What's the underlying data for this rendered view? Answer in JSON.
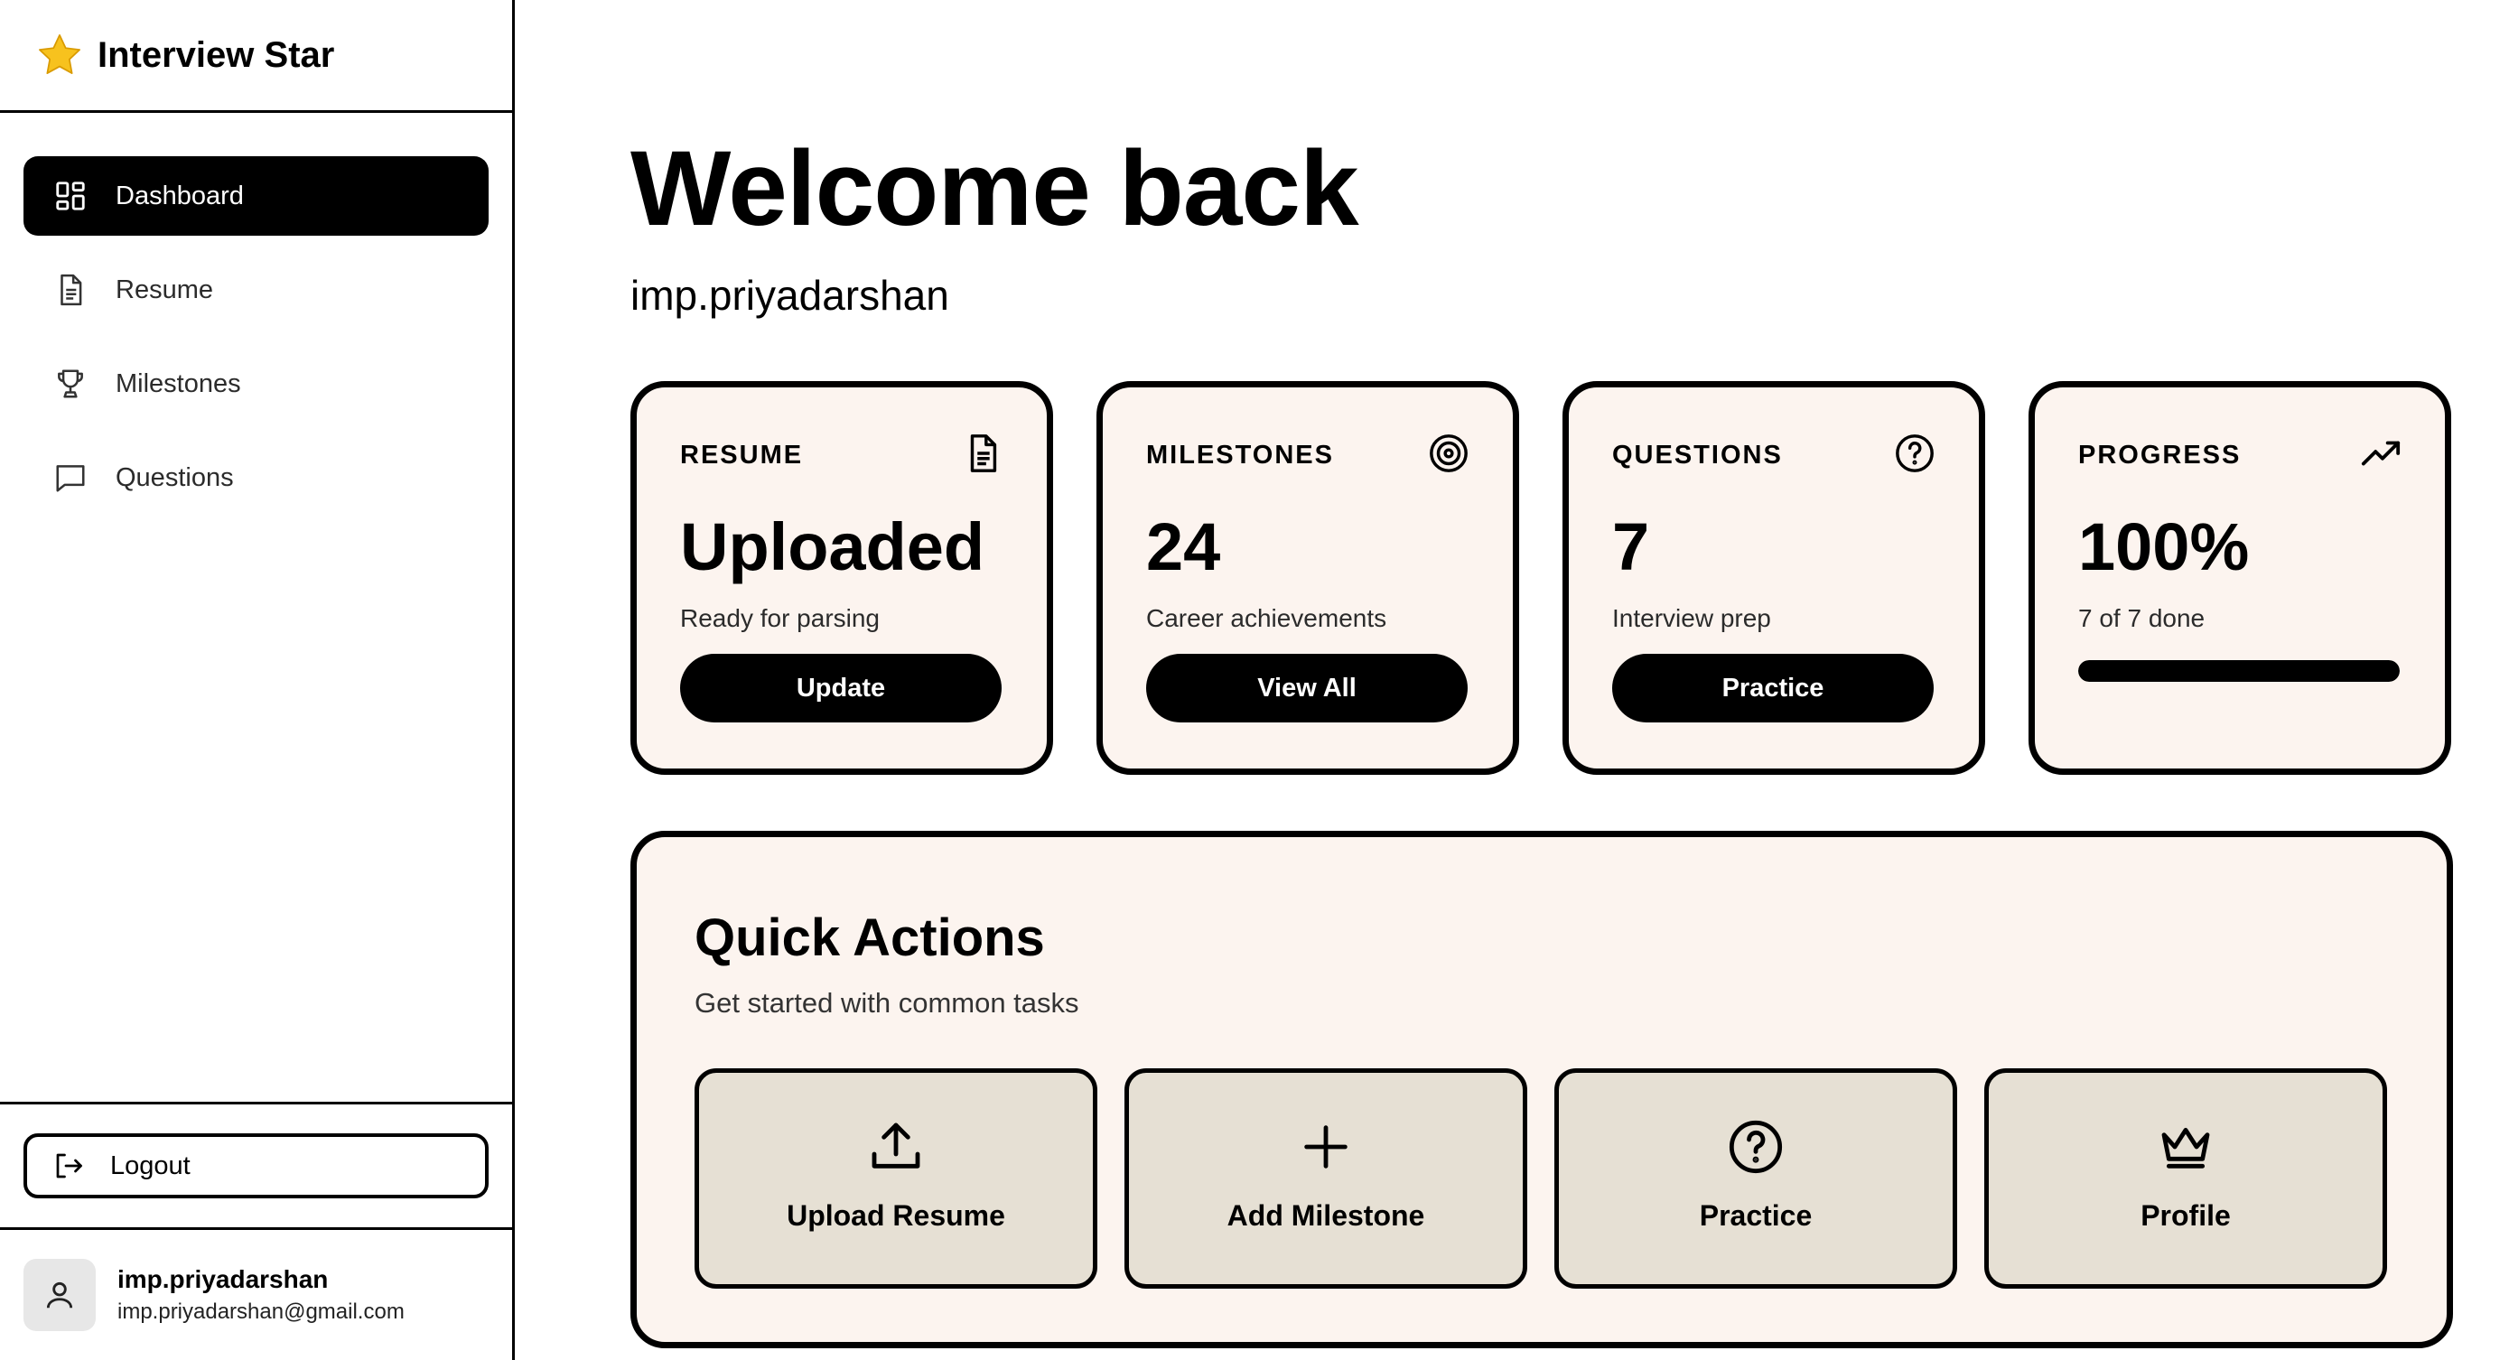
{
  "app": {
    "name": "Interview Star"
  },
  "sidebar": {
    "items": [
      {
        "label": "Dashboard",
        "icon": "dashboard-icon",
        "active": true
      },
      {
        "label": "Resume",
        "icon": "document-icon",
        "active": false
      },
      {
        "label": "Milestones",
        "icon": "trophy-icon",
        "active": false
      },
      {
        "label": "Questions",
        "icon": "chat-icon",
        "active": false
      }
    ],
    "logout_label": "Logout",
    "user": {
      "name": "imp.priyadarshan",
      "email": "imp.priyadarshan@gmail.com"
    }
  },
  "main": {
    "welcome": "Welcome back",
    "username": "imp.priyadarshan",
    "stats": [
      {
        "label": "RESUME",
        "value": "Uploaded",
        "sub": "Ready for parsing",
        "button": "Update",
        "icon": "document-icon"
      },
      {
        "label": "MILESTONES",
        "value": "24",
        "sub": "Career achievements",
        "button": "View All",
        "icon": "target-icon"
      },
      {
        "label": "QUESTIONS",
        "value": "7",
        "sub": "Interview prep",
        "button": "Practice",
        "icon": "question-circle-icon"
      },
      {
        "label": "PROGRESS",
        "value": "100%",
        "sub": "7 of 7 done",
        "progress": 1.0,
        "icon": "trending-up-icon"
      }
    ],
    "quick_actions": {
      "title": "Quick Actions",
      "subtitle": "Get started with common tasks",
      "items": [
        {
          "label": "Upload Resume",
          "icon": "upload-icon"
        },
        {
          "label": "Add Milestone",
          "icon": "plus-icon"
        },
        {
          "label": "Practice",
          "icon": "question-circle-icon"
        },
        {
          "label": "Profile",
          "icon": "crown-icon"
        }
      ]
    }
  },
  "colors": {
    "card_bg": "#fcf4ef",
    "action_bg": "#e6e0d4",
    "accent": "#000000",
    "star": "#f5b400"
  }
}
